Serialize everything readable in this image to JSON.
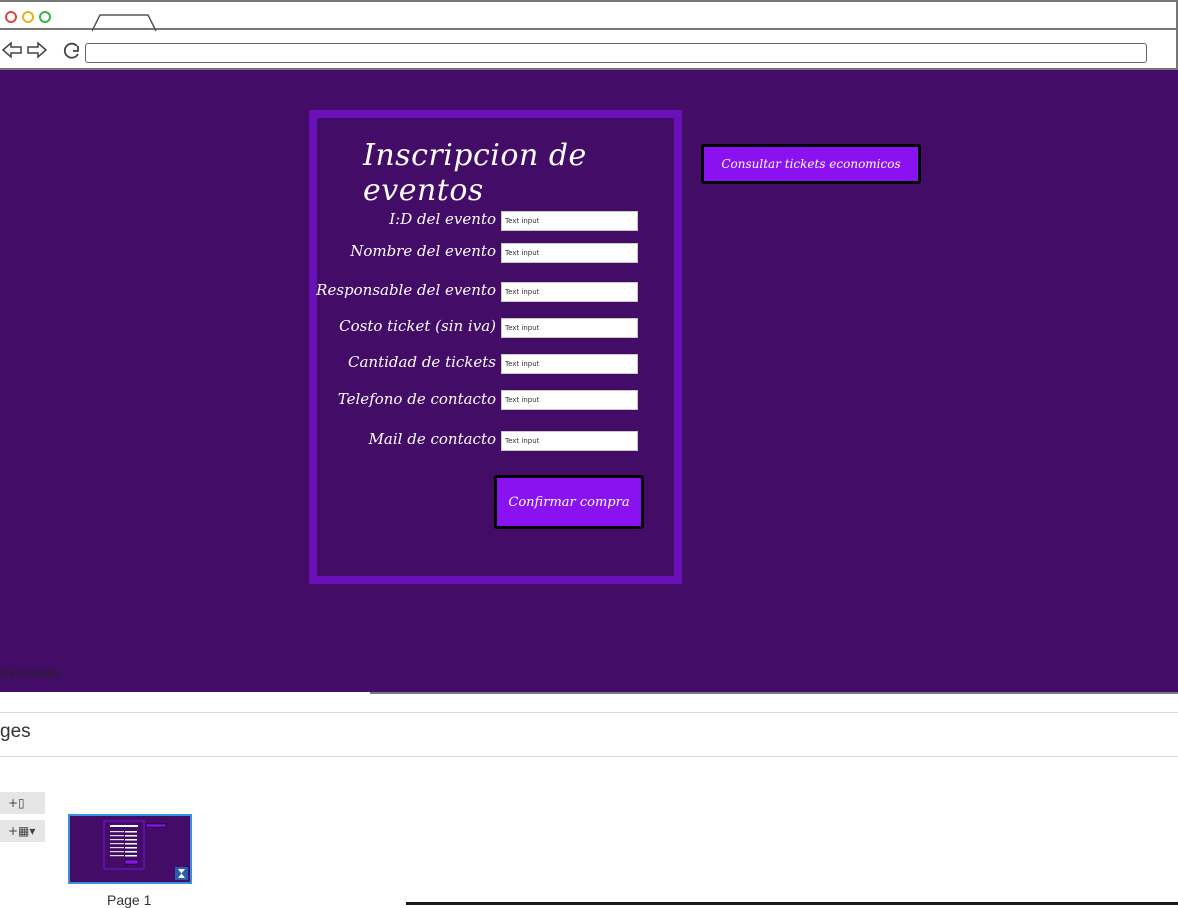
{
  "form": {
    "title": "Inscripcion de eventos",
    "fields": [
      {
        "label": "I:D del evento",
        "placeholder": "Text input"
      },
      {
        "label": "Nombre del evento",
        "placeholder": "Text input"
      },
      {
        "label": "Responsable del evento",
        "placeholder": "Text input"
      },
      {
        "label": "Costo ticket (sin iva)",
        "placeholder": "Text input"
      },
      {
        "label": "Cantidad de tickets",
        "placeholder": "Text input"
      },
      {
        "label": "Telefono de contacto",
        "placeholder": "Text input"
      },
      {
        "label": "Mail de contacto",
        "placeholder": "Text input"
      }
    ],
    "confirm_label": "Confirmar compra"
  },
  "consult_button_label": "Consultar tickets economicos",
  "status": {
    "elements_count": "0 Elements"
  },
  "pages_panel": {
    "title": "ges",
    "add_page_label": "+▯",
    "add_template_label": "+▦▾",
    "page_label": "Page 1"
  },
  "colors": {
    "canvas": "#420c67",
    "panel_border": "#6a10b8",
    "button": "#8a12f0"
  },
  "icons": [
    "back-arrow-icon",
    "forward-arrow-icon",
    "reload-icon",
    "hourglass-icon"
  ]
}
